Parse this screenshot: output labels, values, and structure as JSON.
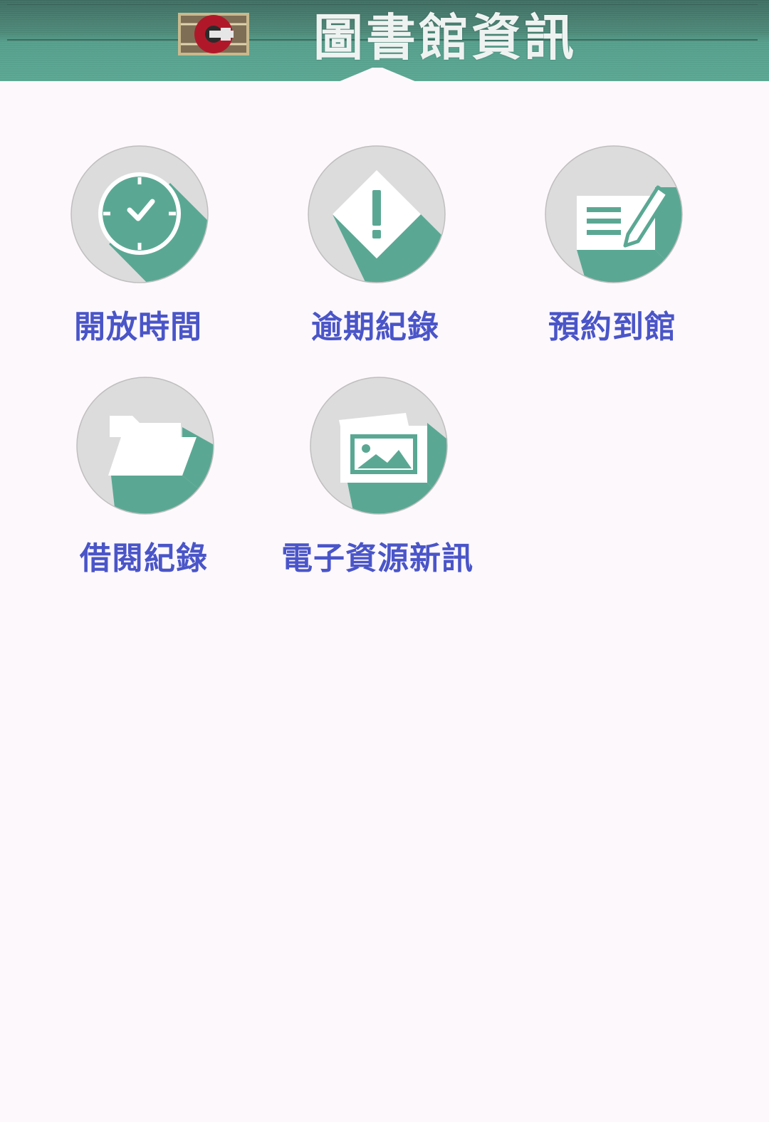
{
  "header": {
    "title": "圖書館資訊",
    "logo_icon": "library-logo-icon"
  },
  "colors": {
    "accent": "#5aa893",
    "circle_bg": "#dcdcdc",
    "label": "#4a55c8",
    "background": "#fdf8fc"
  },
  "menu": {
    "items": [
      {
        "label": "開放時間",
        "icon": "clock-icon"
      },
      {
        "label": "逾期紀錄",
        "icon": "alert-diamond-icon"
      },
      {
        "label": "預約到館",
        "icon": "reserve-note-icon"
      },
      {
        "label": "借閱紀錄",
        "icon": "folder-icon"
      },
      {
        "label": "電子資源新訊",
        "icon": "image-gallery-icon"
      }
    ]
  }
}
